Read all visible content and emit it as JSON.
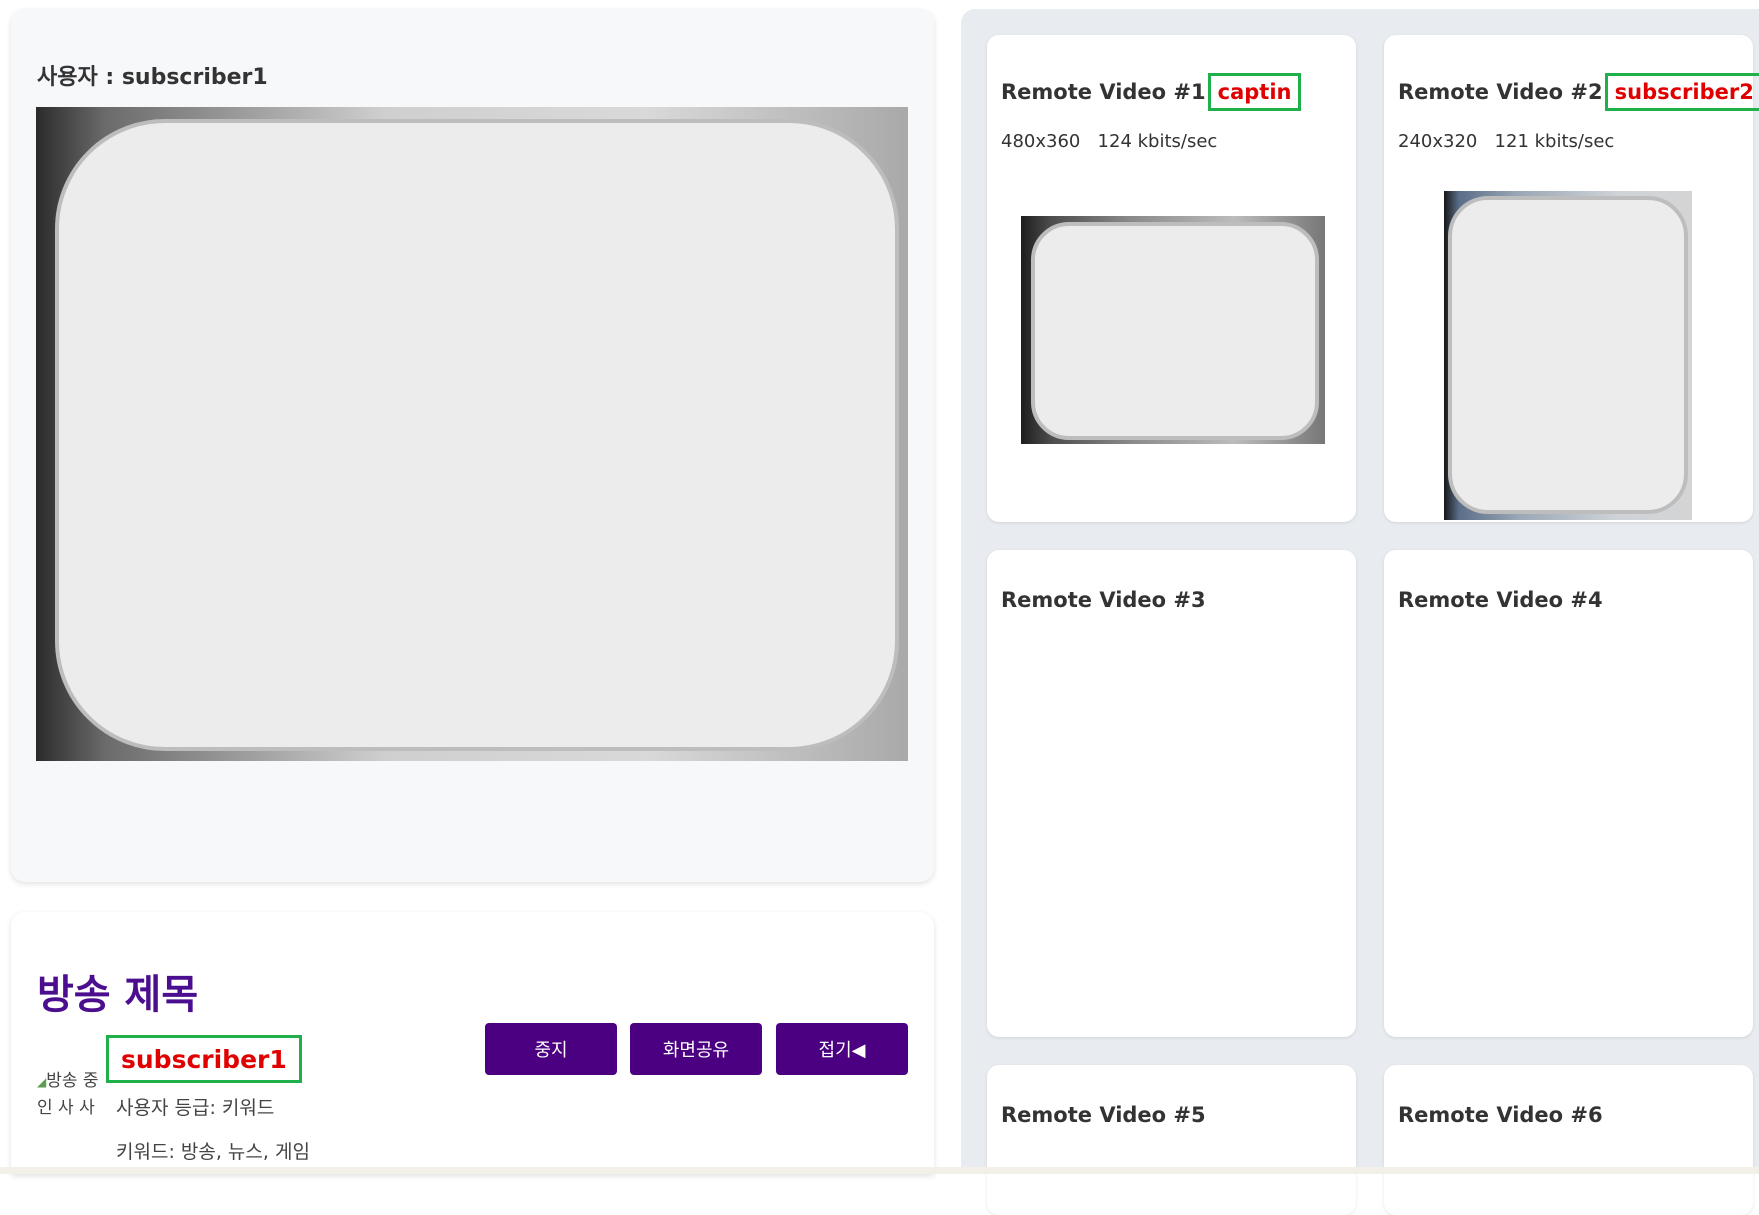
{
  "local": {
    "user_label": "사용자 : subscriber1"
  },
  "broadcast": {
    "title": "방송 제목",
    "avatar_alt": "방송 중인 사 사 프로",
    "username": "subscriber1",
    "grade_line": "사용자 등급: 키워드",
    "keyword_line": "키워드: 방송, 뉴스, 게임",
    "buttons": {
      "stop": "중지",
      "share": "화면공유",
      "fold": "접기◀"
    }
  },
  "remote": {
    "videos": [
      {
        "title": "Remote Video #1",
        "user": "captin",
        "resolution": "480x360",
        "bitrate": "124 kbits/sec"
      },
      {
        "title": "Remote Video #2",
        "user": "subscriber2",
        "resolution": "240x320",
        "bitrate": "121 kbits/sec"
      },
      {
        "title": "Remote Video #3"
      },
      {
        "title": "Remote Video #4"
      },
      {
        "title": "Remote Video #5"
      },
      {
        "title": "Remote Video #6"
      }
    ]
  },
  "colors": {
    "accent_purple": "#4b0082",
    "title_purple": "#4a0e8f",
    "highlight_red": "#e10000",
    "highlight_green": "#1fb04b"
  }
}
